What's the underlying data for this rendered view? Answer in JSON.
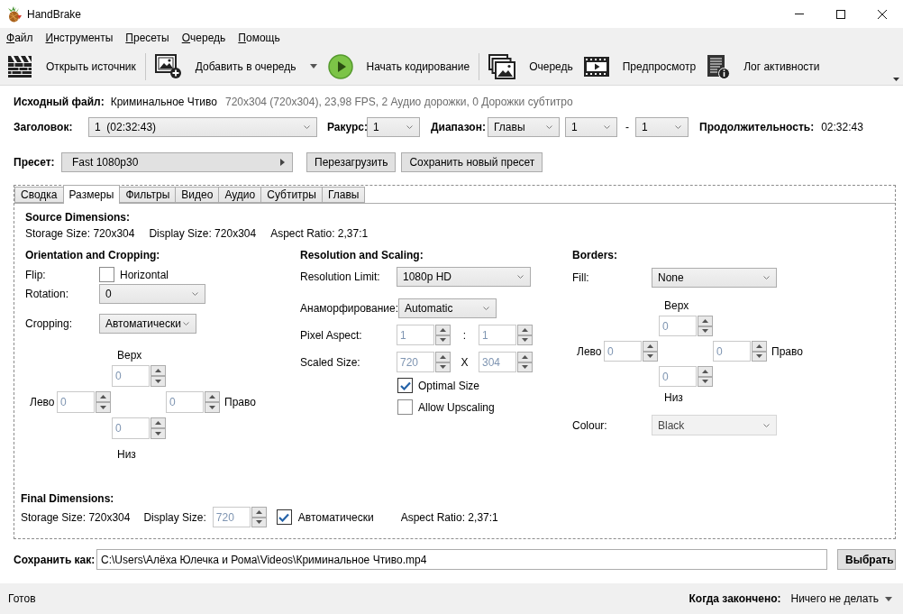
{
  "window": {
    "title": "HandBrake"
  },
  "menu": [
    "Файл",
    "Инструменты",
    "Пресеты",
    "Очередь",
    "Помощь"
  ],
  "toolbar": [
    {
      "kind": "button",
      "label": "Открыть источник"
    },
    {
      "kind": "separator"
    },
    {
      "kind": "dropdown",
      "label": "Добавить в очередь"
    },
    {
      "kind": "button",
      "label": "Начать кодирование"
    },
    {
      "kind": "separator"
    },
    {
      "kind": "button",
      "label": "Очередь"
    },
    {
      "kind": "button",
      "label": "Предпросмотр"
    },
    {
      "kind": "button",
      "label": "Лог активности"
    }
  ],
  "source": {
    "label": "Исходный файл:",
    "name": "Криминальное Чтиво",
    "details": "720x304 (720x304), 23,98 FPS, 2 Аудио дорожки, 0 Дорожки субтитро"
  },
  "title_row": {
    "title": {
      "label": "Заголовок:",
      "value": "1  (02:32:43)"
    },
    "angle": {
      "label": "Ракурс:",
      "value": "1"
    },
    "range": {
      "label": "Диапазон:",
      "mode": "Главы",
      "start": "1",
      "separator": "-",
      "end": "1"
    },
    "duration": {
      "label": "Продолжительность:",
      "value": "02:32:43"
    }
  },
  "preset_row": {
    "label": "Пресет:",
    "preset": "Fast 1080p30",
    "buttons": [
      "Перезагрузить",
      "Сохранить новый пресет"
    ]
  },
  "tabs": [
    {
      "label": "Сводка",
      "selected": false
    },
    {
      "label": "Размеры",
      "selected": true
    },
    {
      "label": "Фильтры",
      "selected": false
    },
    {
      "label": "Видео",
      "selected": false
    },
    {
      "label": "Аудио",
      "selected": false
    },
    {
      "label": "Субтитры",
      "selected": false
    },
    {
      "label": "Главы",
      "selected": false
    }
  ],
  "dimensions": {
    "source": {
      "heading": "Source Dimensions:",
      "items": [
        "Storage Size: 720x304",
        "Display Size: 720x304",
        "Aspect Ratio: 2,37:1"
      ]
    },
    "orientation": {
      "heading": "Orientation and Cropping:",
      "flip": {
        "label": "Flip:",
        "option": "Horizontal",
        "checked": false
      },
      "rotation": {
        "label": "Rotation:",
        "value": "0"
      },
      "cropping": {
        "label": "Cropping:",
        "value": "Автоматически"
      },
      "crop": {
        "top": {
          "label": "Верх",
          "value": "0"
        },
        "left": {
          "label": "Лево",
          "value": "0"
        },
        "right": {
          "label": "Право",
          "value": "0"
        },
        "bottom": {
          "label": "Низ",
          "value": "0"
        }
      }
    },
    "resolution": {
      "heading": "Resolution and Scaling:",
      "limit": {
        "label": "Resolution Limit:",
        "value": "1080p HD"
      },
      "anamorphic": {
        "label": "Анаморфирование:",
        "value": "Automatic"
      },
      "pixel_aspect": {
        "label": "Pixel Aspect:",
        "values": [
          "1",
          "1"
        ],
        "separator": ":"
      },
      "scaled_size": {
        "label": "Scaled Size:",
        "values": [
          "720",
          "304"
        ],
        "separator": "X"
      },
      "options": [
        {
          "label": "Optimal Size",
          "checked": true
        },
        {
          "label": "Allow Upscaling",
          "checked": false
        }
      ]
    },
    "borders": {
      "heading": "Borders:",
      "fill": {
        "label": "Fill:",
        "value": "None"
      },
      "sides": {
        "top": {
          "label": "Верх",
          "value": "0"
        },
        "left": {
          "label": "Лево",
          "value": "0"
        },
        "right": {
          "label": "Право",
          "value": "0"
        },
        "bottom": {
          "label": "Низ",
          "value": "0"
        }
      },
      "colour": {
        "label": "Colour:",
        "value": "Black",
        "disabled": true
      }
    },
    "final": {
      "heading": "Final Dimensions:",
      "storage": "Storage Size: 720x304",
      "display": {
        "label": "Display Size:",
        "value": "720"
      },
      "auto": {
        "label": "Автоматически",
        "checked": true
      },
      "aspect": "Aspect Ratio: 2,37:1"
    }
  },
  "save": {
    "label": "Сохранить как:",
    "path": "C:\\Users\\Алёха Юлечка и Рома\\Videos\\Криминальное Чтиво.mp4",
    "button": "Выбрать"
  },
  "status_bar": {
    "status": "Готов",
    "when_done_label": "Когда закончено:",
    "when_done": "Ничего не делать"
  }
}
